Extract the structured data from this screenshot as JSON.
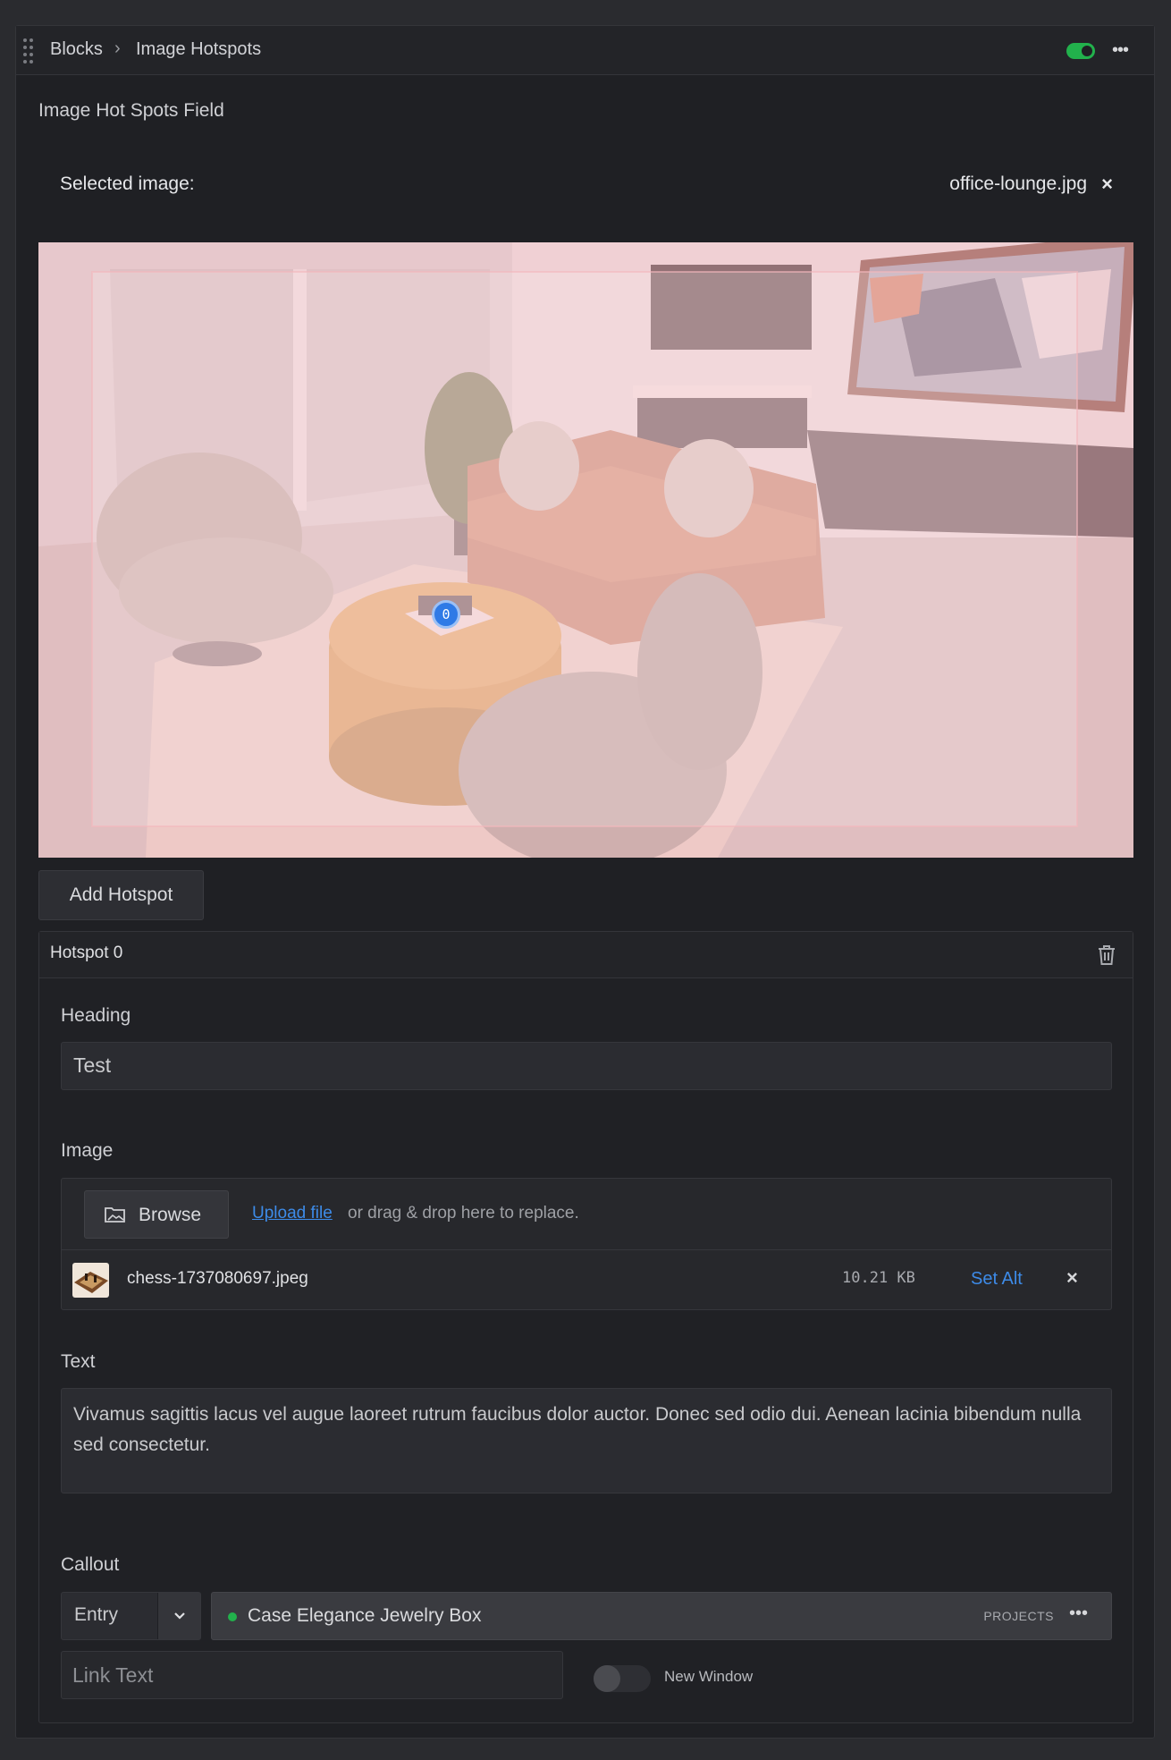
{
  "header": {
    "breadcrumb_root": "Blocks",
    "breadcrumb_separator": "›",
    "breadcrumb_current": "Image Hotspots",
    "enabled": true,
    "more_icon": "more-horizontal-icon"
  },
  "field": {
    "title": "Image Hot Spots Field",
    "selected_label": "Selected image:",
    "selected_file": "office-lounge.jpg",
    "clear_icon": "×"
  },
  "hotspot_image": {
    "markers": [
      {
        "label": "0"
      }
    ]
  },
  "add_hotspot_label": "Add Hotspot",
  "hotspot": {
    "title": "Hotspot 0",
    "delete_icon": "trash-icon",
    "heading_label": "Heading",
    "heading_value": "Test",
    "image_label": "Image",
    "browse_label": "Browse",
    "upload_link": "Upload file",
    "upload_rest": "or drag & drop here to replace.",
    "file_name": "chess-1737080697.jpeg",
    "file_size": "10.21 KB",
    "set_alt_label": "Set Alt",
    "remove_icon": "×",
    "text_label": "Text",
    "text_value": "Vivamus sagittis lacus vel augue laoreet rutrum faucibus dolor auctor. Donec sed odio dui. Aenean lacinia bibendum nulla sed consectetur.",
    "callout_label": "Callout",
    "callout_type": "Entry",
    "callout_entry": "Case Elegance Jewelry Box",
    "callout_section": "PROJECTS",
    "link_text_placeholder": "Link Text",
    "new_window_label": "New Window",
    "new_window": false
  },
  "colors": {
    "accent_blue": "#3d8be8",
    "status_green": "#22b14c",
    "overlay_pink": "#f4b8bd"
  }
}
